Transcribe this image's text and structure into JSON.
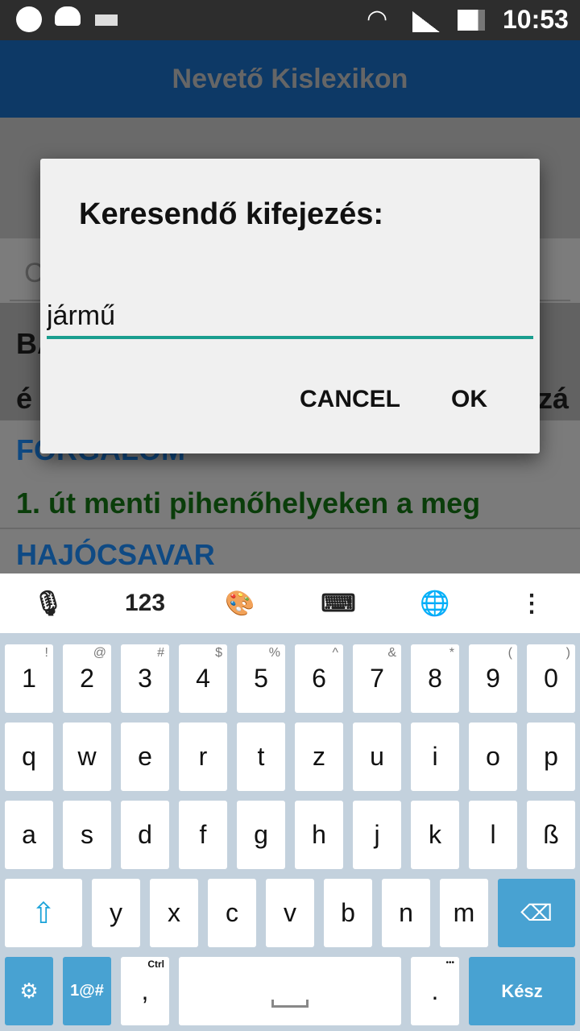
{
  "status_bar": {
    "time": "10:53",
    "icons": [
      "aperture-icon",
      "weather-icon",
      "keyboard-icon",
      "wifi-icon",
      "signal-icon",
      "battery-icon"
    ]
  },
  "app_bar": {
    "title": "Nevető Kislexikon"
  },
  "background": {
    "search_placeholder_partial": "C",
    "line1_partial": "BA",
    "line2_left_partial": "é",
    "line2_right_partial": "zá",
    "entries": [
      {
        "title": "FORGALOM",
        "text": "1. út menti pihenőhelyeken a meg"
      },
      {
        "title": "HAJÓCSAVAR"
      }
    ]
  },
  "dialog": {
    "title": "Keresendő kifejezés:",
    "input_value": "jármű",
    "cancel_label": "CANCEL",
    "ok_label": "OK"
  },
  "keyboard": {
    "toolbar": {
      "numbers_label": "123",
      "icons": [
        "microphone-icon",
        "palette-icon",
        "hide-keyboard-icon",
        "globe-icon",
        "more-icon"
      ]
    },
    "row1": [
      {
        "k": "1",
        "s": "!"
      },
      {
        "k": "2",
        "s": "@"
      },
      {
        "k": "3",
        "s": "#"
      },
      {
        "k": "4",
        "s": "$"
      },
      {
        "k": "5",
        "s": "%"
      },
      {
        "k": "6",
        "s": "^"
      },
      {
        "k": "7",
        "s": "&"
      },
      {
        "k": "8",
        "s": "*"
      },
      {
        "k": "9",
        "s": "("
      },
      {
        "k": "0",
        "s": ")"
      }
    ],
    "row2": [
      "q",
      "w",
      "e",
      "r",
      "t",
      "z",
      "u",
      "i",
      "o",
      "p"
    ],
    "row3": [
      "a",
      "s",
      "d",
      "f",
      "g",
      "h",
      "j",
      "k",
      "l",
      "ß"
    ],
    "row4": [
      "y",
      "x",
      "c",
      "v",
      "b",
      "n",
      "m"
    ],
    "symbols_label": "1@#",
    "comma": ",",
    "comma_hint": "Ctrl",
    "period": ".",
    "period_hint": "•••",
    "done_label": "Kész",
    "accent": "#48a2d2"
  }
}
